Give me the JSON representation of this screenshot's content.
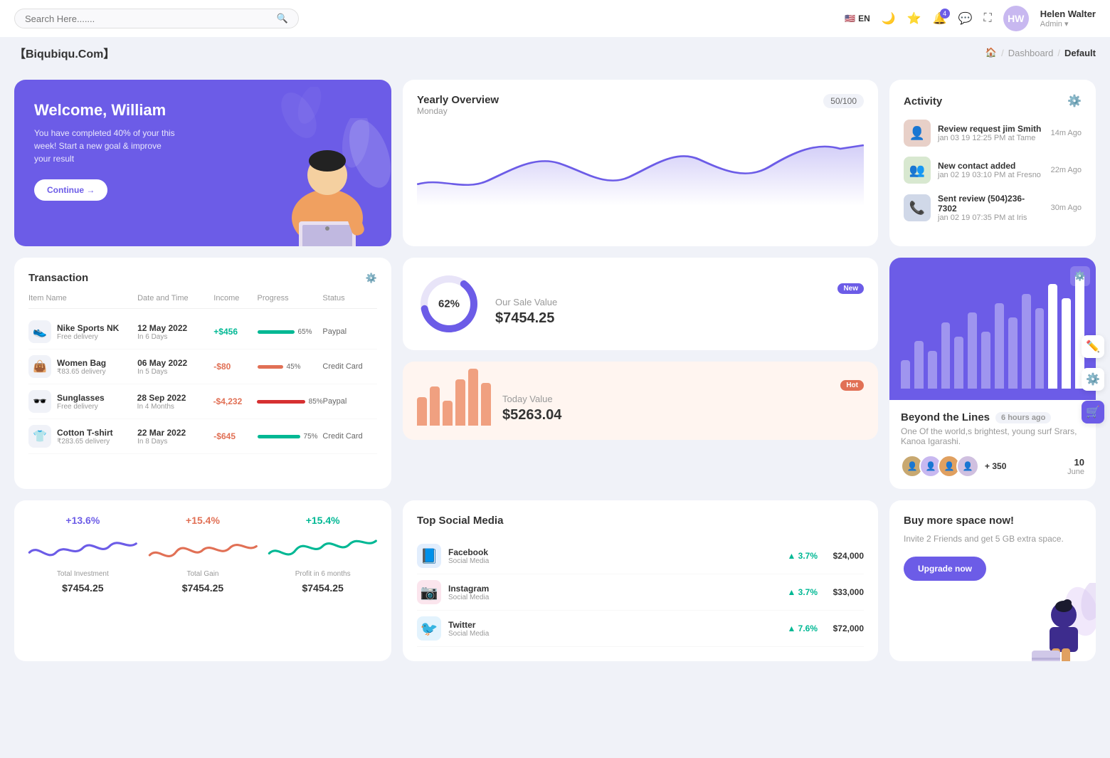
{
  "topNav": {
    "searchPlaceholder": "Search Here.......",
    "language": "EN",
    "notificationCount": "4",
    "user": {
      "name": "Helen Walter",
      "role": "Admin",
      "initials": "HW"
    }
  },
  "breadcrumb": {
    "brand": "【Biqubiqu.Com】",
    "home": "🏠",
    "items": [
      "Dashboard",
      "Default"
    ]
  },
  "welcome": {
    "greeting": "Welcome, William",
    "message": "You have completed 40% of your this week! Start a new goal & improve your result",
    "button": "Continue →"
  },
  "yearlyOverview": {
    "title": "Yearly Overview",
    "day": "Monday",
    "badge": "50/100"
  },
  "activity": {
    "title": "Activity",
    "items": [
      {
        "title": "Review request jim Smith",
        "sub": "jan 03 19 12:25 PM at Tame",
        "time": "14m Ago",
        "emoji": "👤"
      },
      {
        "title": "New contact added",
        "sub": "jan 02 19 03:10 PM at Fresno",
        "time": "22m Ago",
        "emoji": "👥"
      },
      {
        "title": "Sent review (504)236-7302",
        "sub": "jan 02 19 07:35 PM at Iris",
        "time": "30m Ago",
        "emoji": "📞"
      }
    ]
  },
  "transaction": {
    "title": "Transaction",
    "headers": [
      "Item Name",
      "Date and Time",
      "Income",
      "Progress",
      "Status"
    ],
    "rows": [
      {
        "name": "Nike Sports NK",
        "sub": "Free delivery",
        "date": "12 May 2022",
        "days": "In 6 Days",
        "income": "+$456",
        "positive": true,
        "progress": 65,
        "progressColor": "#00b894",
        "status": "Paypal",
        "emoji": "👟"
      },
      {
        "name": "Women Bag",
        "sub": "₹83.65 delivery",
        "date": "06 May 2022",
        "days": "In 5 Days",
        "income": "-$80",
        "positive": false,
        "progress": 45,
        "progressColor": "#e17055",
        "status": "Credit Card",
        "emoji": "👜"
      },
      {
        "name": "Sunglasses",
        "sub": "Free delivery",
        "date": "28 Sep 2022",
        "days": "In 4 Months",
        "income": "-$4,232",
        "positive": false,
        "progress": 85,
        "progressColor": "#d63031",
        "status": "Paypal",
        "emoji": "🕶️"
      },
      {
        "name": "Cotton T-shirt",
        "sub": "₹283.65 delivery",
        "date": "22 Mar 2022",
        "days": "In 8 Days",
        "income": "-$645",
        "positive": false,
        "progress": 75,
        "progressColor": "#00b894",
        "status": "Credit Card",
        "emoji": "👕"
      }
    ]
  },
  "saleValue": {
    "title": "Our Sale Value",
    "amount": "$7454.25",
    "percent": 62,
    "badge": "New"
  },
  "todayValue": {
    "title": "Today Value",
    "amount": "$5263.04",
    "badge": "Hot",
    "bars": [
      40,
      55,
      35,
      65,
      80,
      60
    ]
  },
  "beyond": {
    "title": "Beyond the Lines",
    "timeAgo": "6 hours ago",
    "description": "One Of the world,s brightest, young surf Srars, Kanoa Igarashi.",
    "plusCount": "+ 350",
    "date": "10",
    "month": "June",
    "bars": [
      30,
      50,
      40,
      70,
      55,
      80,
      60,
      90,
      75,
      100,
      85,
      110,
      95,
      120
    ]
  },
  "stats": [
    {
      "percent": "+13.6%",
      "color": "#6c5ce7",
      "label": "Total Investment",
      "amount": "$7454.25"
    },
    {
      "percent": "+15.4%",
      "color": "#e17055",
      "label": "Total Gain",
      "amount": "$7454.25"
    },
    {
      "percent": "+15.4%",
      "color": "#00b894",
      "label": "Profit in 6 months",
      "amount": "$7454.25"
    }
  ],
  "socialMedia": {
    "title": "Top Social Media",
    "items": [
      {
        "name": "Facebook",
        "type": "Social Media",
        "percent": "3.7%",
        "amount": "$24,000",
        "emoji": "📘",
        "color": "#1877f2"
      },
      {
        "name": "Instagram",
        "type": "Social Media",
        "percent": "3.7%",
        "amount": "$33,000",
        "emoji": "📷",
        "color": "#e1306c"
      },
      {
        "name": "Twitter",
        "type": "Social Media",
        "percent": "7.6%",
        "amount": "$72,000",
        "emoji": "🐦",
        "color": "#1da1f2"
      }
    ]
  },
  "buySpace": {
    "title": "Buy more space now!",
    "description": "Invite 2 Friends and get 5 GB extra space.",
    "button": "Upgrade now"
  }
}
